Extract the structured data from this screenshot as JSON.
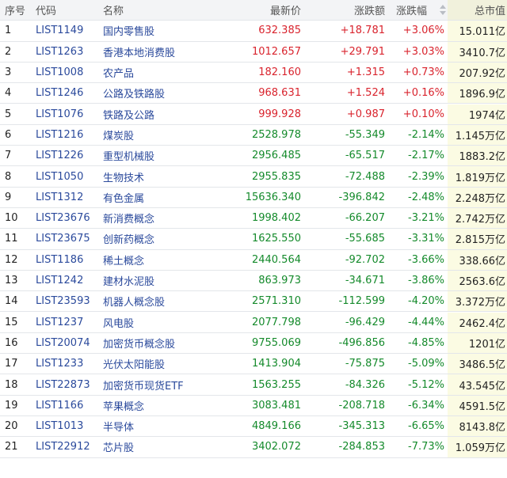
{
  "header": {
    "index": "序号",
    "code": "代码",
    "name": "名称",
    "price": "最新价",
    "change": "涨跌额",
    "pct": "涨跌幅",
    "cap": "总市值"
  },
  "colors": {
    "up": "#d9232d",
    "down": "#148a2b",
    "link": "#2b4a9c"
  },
  "rows": [
    {
      "index": "1",
      "code": "LIST1149",
      "name": "国内零售股",
      "price": "632.385",
      "change": "+18.781",
      "pct": "+3.06%",
      "cap": "15.011亿",
      "dir": "up"
    },
    {
      "index": "2",
      "code": "LIST1263",
      "name": "香港本地消费股",
      "price": "1012.657",
      "change": "+29.791",
      "pct": "+3.03%",
      "cap": "3410.7亿",
      "dir": "up"
    },
    {
      "index": "3",
      "code": "LIST1008",
      "name": "农产品",
      "price": "182.160",
      "change": "+1.315",
      "pct": "+0.73%",
      "cap": "207.92亿",
      "dir": "up"
    },
    {
      "index": "4",
      "code": "LIST1246",
      "name": "公路及铁路股",
      "price": "968.631",
      "change": "+1.524",
      "pct": "+0.16%",
      "cap": "1896.9亿",
      "dir": "up"
    },
    {
      "index": "5",
      "code": "LIST1076",
      "name": "铁路及公路",
      "price": "999.928",
      "change": "+0.987",
      "pct": "+0.10%",
      "cap": "1974亿",
      "dir": "up"
    },
    {
      "index": "6",
      "code": "LIST1216",
      "name": "煤炭股",
      "price": "2528.978",
      "change": "-55.349",
      "pct": "-2.14%",
      "cap": "1.145万亿",
      "dir": "down"
    },
    {
      "index": "7",
      "code": "LIST1226",
      "name": "重型机械股",
      "price": "2956.485",
      "change": "-65.517",
      "pct": "-2.17%",
      "cap": "1883.2亿",
      "dir": "down"
    },
    {
      "index": "8",
      "code": "LIST1050",
      "name": "生物技术",
      "price": "2955.835",
      "change": "-72.488",
      "pct": "-2.39%",
      "cap": "1.819万亿",
      "dir": "down"
    },
    {
      "index": "9",
      "code": "LIST1312",
      "name": "有色金属",
      "price": "15636.340",
      "change": "-396.842",
      "pct": "-2.48%",
      "cap": "2.248万亿",
      "dir": "down"
    },
    {
      "index": "10",
      "code": "LIST23676",
      "name": "新消费概念",
      "price": "1998.402",
      "change": "-66.207",
      "pct": "-3.21%",
      "cap": "2.742万亿",
      "dir": "down"
    },
    {
      "index": "11",
      "code": "LIST23675",
      "name": "创新药概念",
      "price": "1625.550",
      "change": "-55.685",
      "pct": "-3.31%",
      "cap": "2.815万亿",
      "dir": "down"
    },
    {
      "index": "12",
      "code": "LIST1186",
      "name": "稀土概念",
      "price": "2440.564",
      "change": "-92.702",
      "pct": "-3.66%",
      "cap": "338.66亿",
      "dir": "down"
    },
    {
      "index": "13",
      "code": "LIST1242",
      "name": "建材水泥股",
      "price": "863.973",
      "change": "-34.671",
      "pct": "-3.86%",
      "cap": "2563.6亿",
      "dir": "down"
    },
    {
      "index": "14",
      "code": "LIST23593",
      "name": "机器人概念股",
      "price": "2571.310",
      "change": "-112.599",
      "pct": "-4.20%",
      "cap": "3.372万亿",
      "dir": "down"
    },
    {
      "index": "15",
      "code": "LIST1237",
      "name": "风电股",
      "price": "2077.798",
      "change": "-96.429",
      "pct": "-4.44%",
      "cap": "2462.4亿",
      "dir": "down"
    },
    {
      "index": "16",
      "code": "LIST20074",
      "name": "加密货币概念股",
      "price": "9755.069",
      "change": "-496.856",
      "pct": "-4.85%",
      "cap": "1201亿",
      "dir": "down"
    },
    {
      "index": "17",
      "code": "LIST1233",
      "name": "光伏太阳能股",
      "price": "1413.904",
      "change": "-75.875",
      "pct": "-5.09%",
      "cap": "3486.5亿",
      "dir": "down"
    },
    {
      "index": "18",
      "code": "LIST22873",
      "name": "加密货币现货ETF",
      "price": "1563.255",
      "change": "-84.326",
      "pct": "-5.12%",
      "cap": "43.545亿",
      "dir": "down"
    },
    {
      "index": "19",
      "code": "LIST1166",
      "name": "苹果概念",
      "price": "3083.481",
      "change": "-208.718",
      "pct": "-6.34%",
      "cap": "4591.5亿",
      "dir": "down"
    },
    {
      "index": "20",
      "code": "LIST1013",
      "name": "半导体",
      "price": "4849.166",
      "change": "-345.313",
      "pct": "-6.65%",
      "cap": "8143.8亿",
      "dir": "down"
    },
    {
      "index": "21",
      "code": "LIST22912",
      "name": "芯片股",
      "price": "3402.072",
      "change": "-284.853",
      "pct": "-7.73%",
      "cap": "1.059万亿",
      "dir": "down"
    }
  ]
}
